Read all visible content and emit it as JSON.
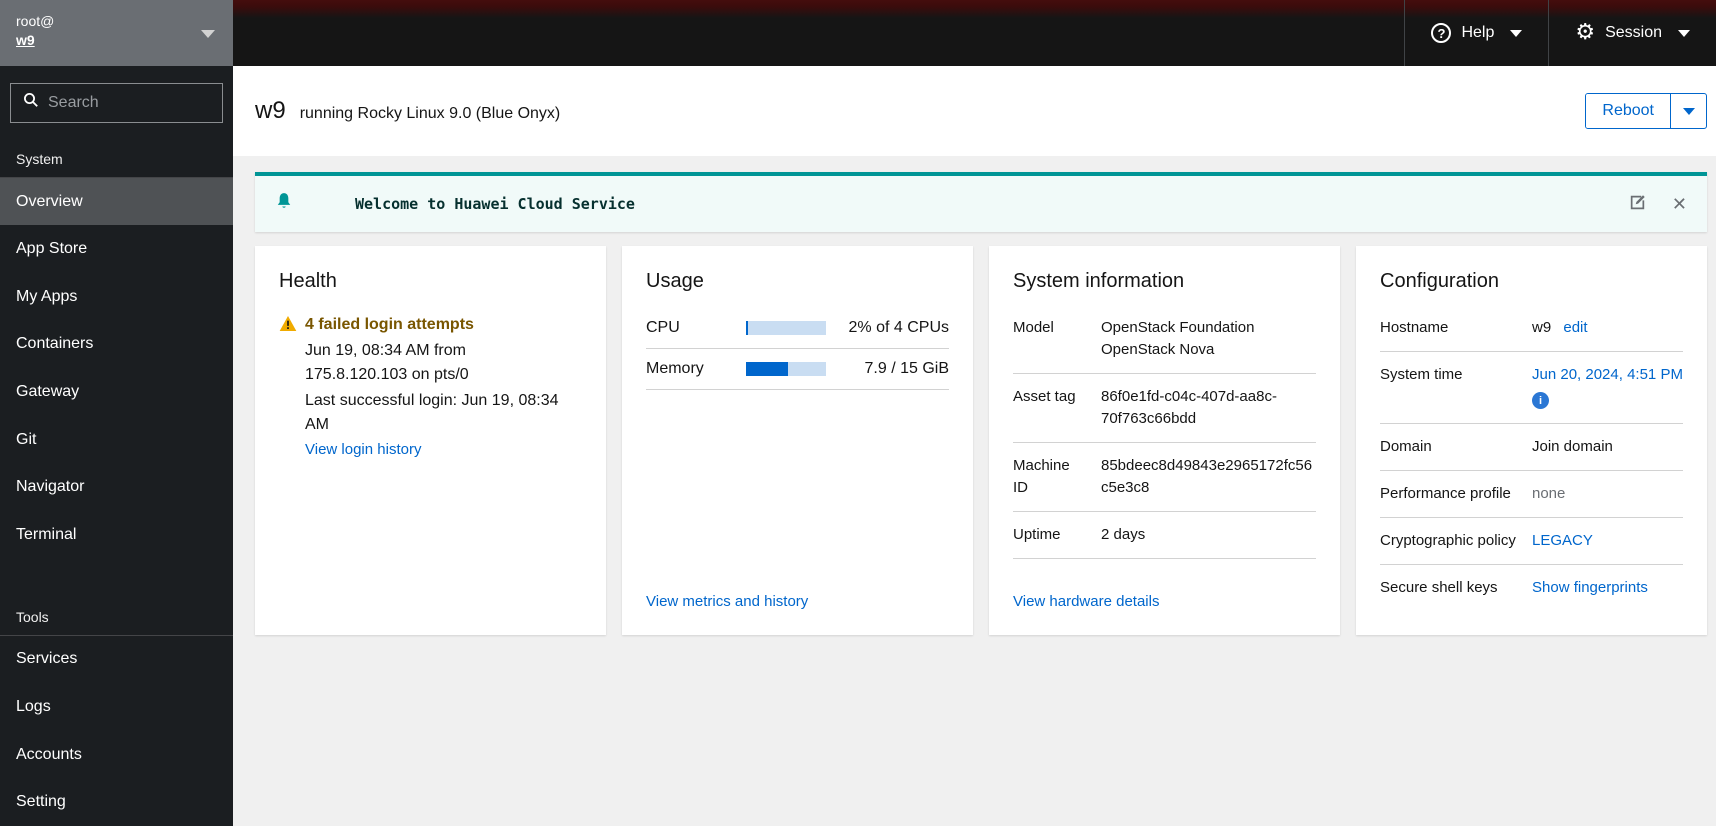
{
  "colors": {
    "accent_blue": "#0066cc",
    "teal": "#009596",
    "warning_gold": "#f0ab00",
    "warning_text": "#795600"
  },
  "sidebar": {
    "user": {
      "name": "root@",
      "host": "w9"
    },
    "search": {
      "placeholder": "Search"
    },
    "sections": [
      {
        "label": "System",
        "items": [
          {
            "label": "Overview",
            "active": true
          },
          {
            "label": "App Store"
          },
          {
            "label": "My Apps"
          },
          {
            "label": "Containers"
          },
          {
            "label": "Gateway"
          },
          {
            "label": "Git"
          },
          {
            "label": "Navigator"
          },
          {
            "label": "Terminal"
          }
        ]
      },
      {
        "label": "Tools",
        "items": [
          {
            "label": "Services"
          },
          {
            "label": "Logs"
          },
          {
            "label": "Accounts"
          },
          {
            "label": "Setting"
          }
        ]
      }
    ]
  },
  "masthead": {
    "help": "Help",
    "session": "Session"
  },
  "page_header": {
    "hostname": "w9",
    "os_text": "running Rocky Linux 9.0 (Blue Onyx)",
    "reboot": "Reboot"
  },
  "banner": {
    "title": "Welcome to Huawei Cloud Service"
  },
  "health": {
    "title": "Health",
    "warning_title": "4 failed login attempts",
    "detail_1": "Jun 19, 08:34 AM from 175.8.120.103 on pts/0",
    "detail_2": "Last successful login: Jun 19, 08:34 AM",
    "link": "View login history"
  },
  "usage": {
    "title": "Usage",
    "rows": [
      {
        "label": "CPU",
        "value": "2% of 4 CPUs",
        "percent": 2
      },
      {
        "label": "Memory",
        "value": "7.9 / 15 GiB",
        "percent": 53
      }
    ],
    "link": "View metrics and history"
  },
  "system_info": {
    "title": "System information",
    "rows": [
      {
        "label": "Model",
        "value": "OpenStack Foundation OpenStack Nova"
      },
      {
        "label": "Asset tag",
        "value": "86f0e1fd-c04c-407d-aa8c-70f763c66bdd"
      },
      {
        "label": "Machine ID",
        "value": "85bdeec8d49843e2965172fc56c5e3c8"
      },
      {
        "label": "Uptime",
        "value": "2 days"
      }
    ],
    "link": "View hardware details"
  },
  "configuration": {
    "title": "Configuration",
    "hostname_label": "Hostname",
    "hostname_value": "w9",
    "hostname_edit": "edit",
    "system_time_label": "System time",
    "system_time_value": "Jun 20, 2024, 4:51 PM",
    "domain_label": "Domain",
    "domain_value": "Join domain",
    "perf_label": "Performance profile",
    "perf_value": "none",
    "crypto_label": "Cryptographic policy",
    "crypto_value": "LEGACY",
    "ssh_label": "Secure shell keys",
    "ssh_value": "Show fingerprints"
  }
}
